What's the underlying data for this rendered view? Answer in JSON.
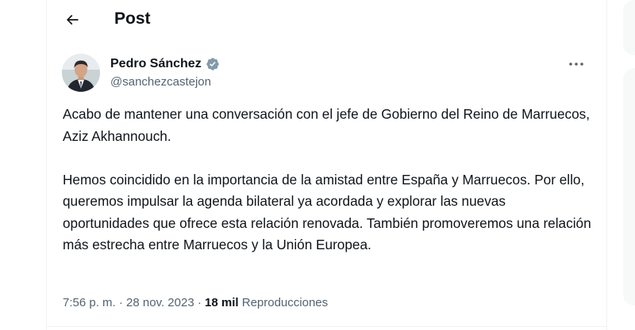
{
  "header": {
    "title": "Post",
    "back_icon": "arrow-left-icon"
  },
  "author": {
    "name": "Pedro Sánchez",
    "handle": "@sanchezcastejon",
    "verified_icon": "verified-badge-icon",
    "verified_color": "#829aab"
  },
  "tweet": {
    "paragraphs": [
      "Acabo de mantener una conversación con el jefe de Gobierno del Reino de Marruecos, Aziz Akhannouch.",
      "Hemos coincidido en la importancia de la amistad entre España y Marruecos. Por ello, queremos impulsar la agenda bilateral ya acordada y explorar las nuevas oportunidades que ofrece esta relación renovada. También promoveremos una relación más estrecha entre Marruecos y la Unión Europea."
    ]
  },
  "meta": {
    "time": "7:56 p. m.",
    "separator": "·",
    "date": "28 nov. 2023",
    "views_count": "18 mil",
    "views_label": "Reproducciones"
  },
  "colors": {
    "text_primary": "#0f1419",
    "text_secondary": "#536471",
    "border": "#eff3f4"
  }
}
